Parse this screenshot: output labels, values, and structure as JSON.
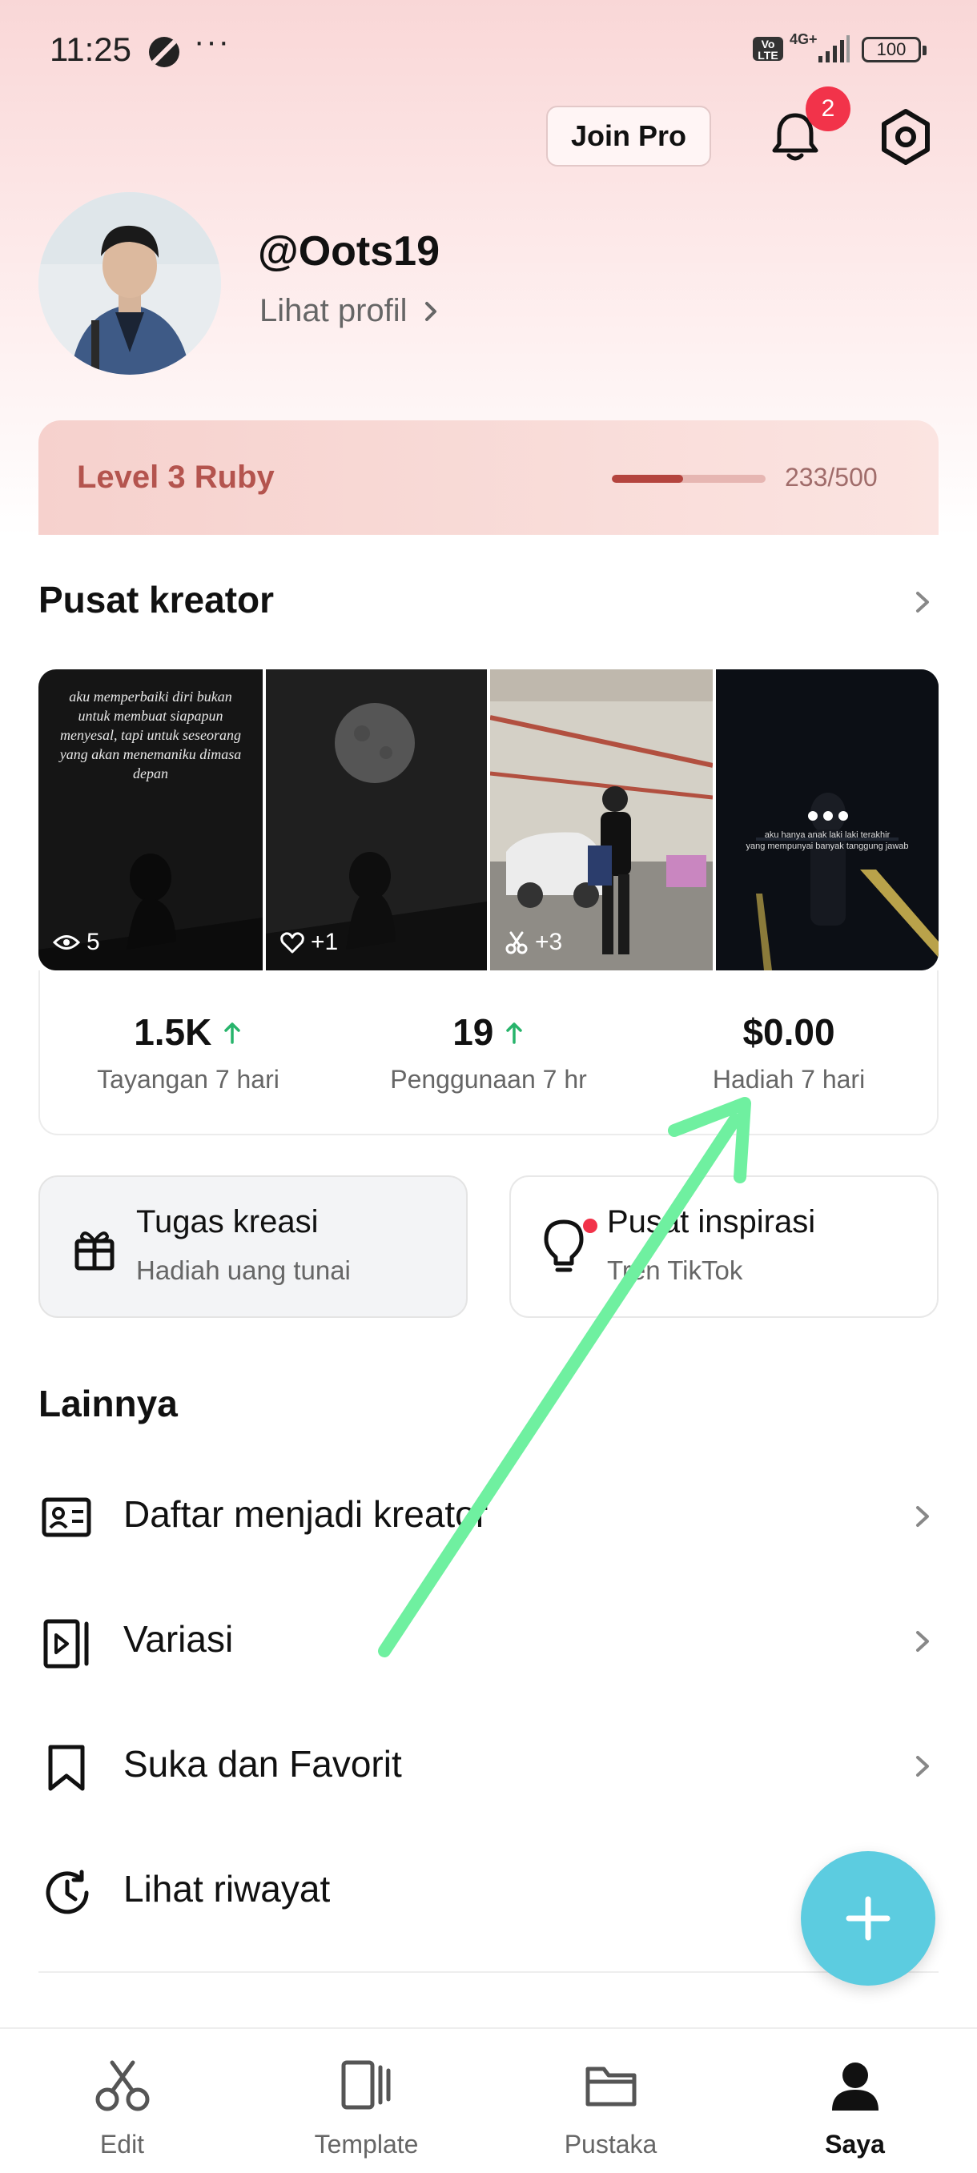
{
  "status_bar": {
    "time": "11:25",
    "dots": "···",
    "volte": "Vo LTE",
    "network": "4G+",
    "battery": "100"
  },
  "header": {
    "join_pro": "Join Pro",
    "notification_count": "2"
  },
  "profile": {
    "username": "@Oots19",
    "view_profile": "Lihat profil"
  },
  "level": {
    "label": "Level 3 Ruby",
    "progress_text": "233/500",
    "progress_fraction": 0.466
  },
  "creator_center": {
    "title": "Pusat kreator",
    "thumbnails": [
      {
        "stat": "5",
        "stat_icon": "eye-icon",
        "caption": "aku memperbaiki diri bukan untuk membuat siapapun menyesal, tapi untuk seseorang yang akan menemaniku dimasa depan"
      },
      {
        "stat": "+1",
        "stat_icon": "heart-icon"
      },
      {
        "stat": "+3",
        "stat_icon": "scissors-icon"
      },
      {
        "stat": "",
        "stat_icon": "more-dots-icon"
      }
    ],
    "stats": [
      {
        "value": "1.5K",
        "label": "Tayangan 7 hari",
        "trend": "up"
      },
      {
        "value": "19",
        "label": "Penggunaan 7 hr",
        "trend": "up"
      },
      {
        "value": "$0.00",
        "label": "Hadiah 7 hari",
        "trend": ""
      }
    ]
  },
  "tasks": [
    {
      "title": "Tugas kreasi",
      "subtitle": "Hadiah uang tunai",
      "icon": "gift-icon"
    },
    {
      "title": "Pusat inspirasi",
      "subtitle": "Tren TikTok",
      "icon": "lightbulb-icon"
    }
  ],
  "more": {
    "title": "Lainnya",
    "items": [
      {
        "label": "Daftar menjadi kreator",
        "icon": "id-card-icon"
      },
      {
        "label": "Variasi",
        "icon": "video-variation-icon"
      },
      {
        "label": "Suka dan Favorit",
        "icon": "bookmark-icon"
      },
      {
        "label": "Lihat riwayat",
        "icon": "history-icon"
      }
    ]
  },
  "nav": [
    {
      "label": "Edit",
      "icon": "scissors-icon"
    },
    {
      "label": "Template",
      "icon": "template-icon"
    },
    {
      "label": "Pustaka",
      "icon": "folder-icon"
    },
    {
      "label": "Saya",
      "icon": "person-icon",
      "active": true
    }
  ],
  "colors": {
    "accent_arrow": "#6ff0a0",
    "fab": "#5ccce0",
    "badge": "#f2334a",
    "level_text": "#b4544e",
    "trend_up": "#27b46b"
  }
}
